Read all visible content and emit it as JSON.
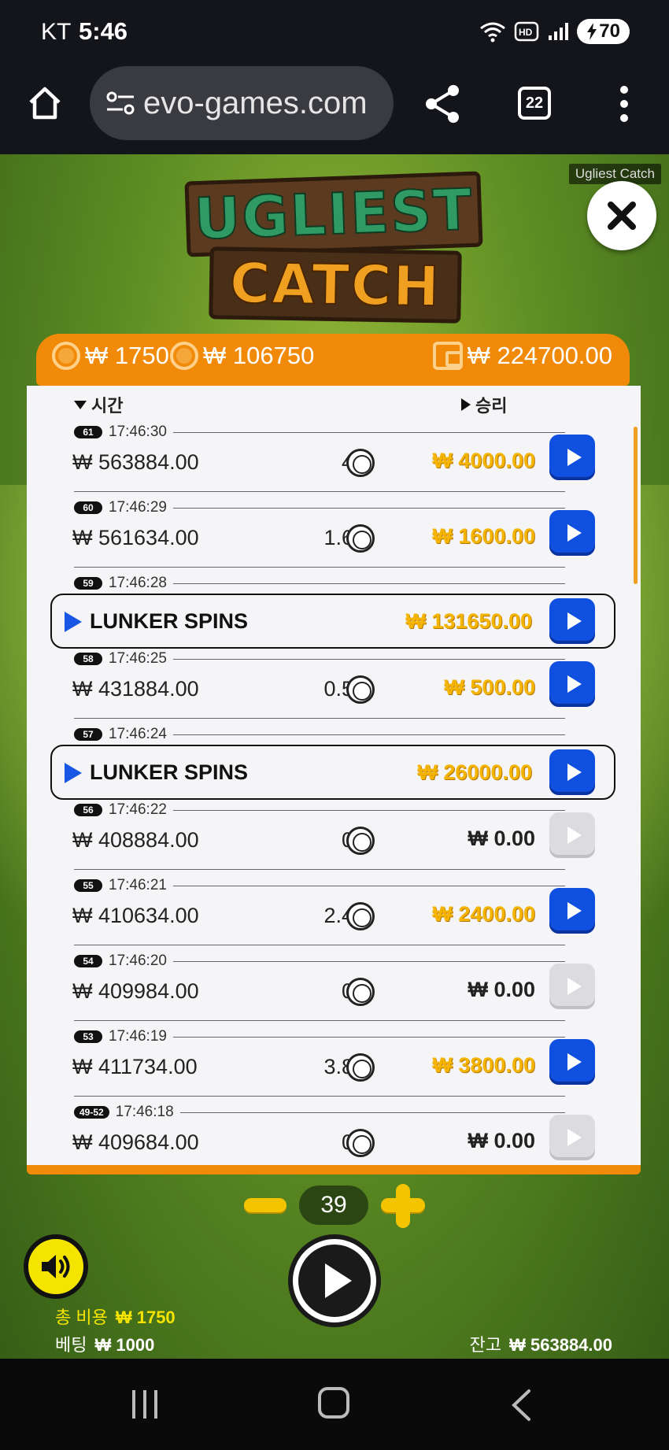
{
  "status_bar": {
    "carrier": "KT",
    "time": "5:46",
    "battery": "70"
  },
  "browser": {
    "url": "evo-games.com",
    "tab_count": "22"
  },
  "game": {
    "name_tag": "Ugliest Catch",
    "logo_line1": "UGLIEST",
    "logo_line2": "CATCH"
  },
  "info_bar": {
    "stake": "₩ 1750",
    "bonus_stake": "₩ 106750",
    "wallet": "₩ 224700.00"
  },
  "table": {
    "col_time": "시간",
    "col_win": "승리"
  },
  "rows": [
    {
      "round": "61",
      "time": "17:46:30",
      "balance": "₩ 563884.00",
      "multiplier": "4 x",
      "win": "₩ 4000.00",
      "win_style": "gold",
      "replay_enabled": true
    },
    {
      "round": "60",
      "time": "17:46:29",
      "balance": "₩ 561634.00",
      "multiplier": "1.6 x",
      "win": "₩ 1600.00",
      "win_style": "gold",
      "replay_enabled": true
    },
    {
      "round": "59",
      "time": "17:46:28",
      "feature": "LUNKER SPINS",
      "win": "₩ 131650.00",
      "win_style": "gold",
      "replay_enabled": true
    },
    {
      "round": "58",
      "time": "17:46:25",
      "balance": "₩ 431884.00",
      "multiplier": "0.5 x",
      "win": "₩ 500.00",
      "win_style": "gold",
      "replay_enabled": true
    },
    {
      "round": "57",
      "time": "17:46:24",
      "feature": "LUNKER SPINS",
      "win": "₩ 26000.00",
      "win_style": "gold",
      "replay_enabled": true
    },
    {
      "round": "56",
      "time": "17:46:22",
      "balance": "₩ 408884.00",
      "multiplier": "0 x",
      "win": "₩ 0.00",
      "win_style": "zero",
      "replay_enabled": false
    },
    {
      "round": "55",
      "time": "17:46:21",
      "balance": "₩ 410634.00",
      "multiplier": "2.4 x",
      "win": "₩ 2400.00",
      "win_style": "gold",
      "replay_enabled": true
    },
    {
      "round": "54",
      "time": "17:46:20",
      "balance": "₩ 409984.00",
      "multiplier": "0 x",
      "win": "₩ 0.00",
      "win_style": "zero",
      "replay_enabled": false
    },
    {
      "round": "53",
      "time": "17:46:19",
      "balance": "₩ 411734.00",
      "multiplier": "3.8 x",
      "win": "₩ 3800.00",
      "win_style": "gold",
      "replay_enabled": true
    },
    {
      "round": "49-52",
      "time": "17:46:18",
      "balance": "₩ 409684.00",
      "multiplier": "0 x",
      "win": "₩ 0.00",
      "win_style": "zero",
      "replay_enabled": false
    }
  ],
  "controls": {
    "stepper_value": "39",
    "total_cost_label": "총 비용",
    "total_cost": "₩ 1750",
    "bet_label": "베팅",
    "bet": "₩ 1000",
    "balance_label": "잔고",
    "balance": "₩ 563884.00"
  }
}
